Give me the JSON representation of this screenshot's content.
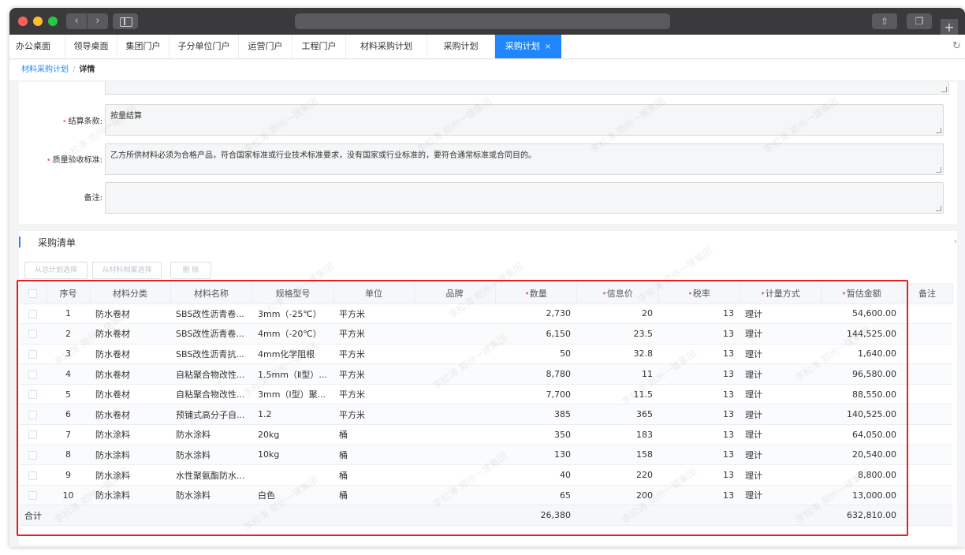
{
  "app_tabs": [
    {
      "label": "办公桌面"
    },
    {
      "label": "领导桌面"
    },
    {
      "label": "集团门户"
    },
    {
      "label": "子分单位门户"
    },
    {
      "label": "运营门户"
    },
    {
      "label": "工程门户"
    },
    {
      "label": "材料采购计划"
    },
    {
      "label": "采购计划"
    },
    {
      "label": "采购计划",
      "active": true,
      "close": "×"
    }
  ],
  "breadcrumb": {
    "link": "材料采购计划",
    "sep": "/",
    "current": "详情"
  },
  "form": {
    "settlement_label": "结算条款:",
    "settlement_value": "按量结算",
    "quality_label": "质量验收标准:",
    "quality_value": "乙方所供材料必须为合格产品，符合国家标准或行业技术标准要求，没有国家或行业标准的，要符合通常标准或合同目的。",
    "remark_label": "备注:",
    "remark_value": "",
    "required_mark": "•"
  },
  "section": {
    "title": "采购清单",
    "right_glyph": "‹"
  },
  "toolbar": {
    "btn_total": "从总计划选择",
    "btn_archive": "从材料档案选择",
    "btn_delete": "删 除"
  },
  "table": {
    "headers": [
      "",
      "序号",
      "材料分类",
      "材料名称",
      "规格型号",
      "单位",
      "品牌",
      "数量",
      "信息价",
      "税率",
      "计量方式",
      "暂估金额",
      "备注"
    ],
    "rows": [
      [
        "1",
        "防水卷材",
        "SBS改性沥青卷...",
        "3mm（-25℃）",
        "平方米",
        "",
        "2,730",
        "20",
        "13",
        "理计",
        "54,600.00",
        ""
      ],
      [
        "2",
        "防水卷材",
        "SBS改性沥青卷...",
        "4mm（-20℃）",
        "平方米",
        "",
        "6,150",
        "23.5",
        "13",
        "理计",
        "144,525.00",
        ""
      ],
      [
        "3",
        "防水卷材",
        "SBS改性沥青抗...",
        "4mm化学阻根",
        "平方米",
        "",
        "50",
        "32.8",
        "13",
        "理计",
        "1,640.00",
        ""
      ],
      [
        "4",
        "防水卷材",
        "自粘聚合物改性...",
        "1.5mm（Ⅱ型）...",
        "平方米",
        "",
        "8,780",
        "11",
        "13",
        "理计",
        "96,580.00",
        ""
      ],
      [
        "5",
        "防水卷材",
        "自粘聚合物改性...",
        "3mm（Ⅰ型）聚...",
        "平方米",
        "",
        "7,700",
        "11.5",
        "13",
        "理计",
        "88,550.00",
        ""
      ],
      [
        "6",
        "防水卷材",
        "预铺式高分子自...",
        "1.2",
        "平方米",
        "",
        "385",
        "365",
        "13",
        "理计",
        "140,525.00",
        ""
      ],
      [
        "7",
        "防水涂料",
        "防水涂料",
        "20kg",
        "桶",
        "",
        "350",
        "183",
        "13",
        "理计",
        "64,050.00",
        ""
      ],
      [
        "8",
        "防水涂料",
        "防水涂料",
        "10kg",
        "桶",
        "",
        "130",
        "158",
        "13",
        "理计",
        "20,540.00",
        ""
      ],
      [
        "9",
        "防水涂料",
        "水性聚氨酯防水...",
        "",
        "桶",
        "",
        "40",
        "220",
        "13",
        "理计",
        "8,800.00",
        ""
      ],
      [
        "10",
        "防水涂料",
        "防水涂料",
        "白色",
        "桶",
        "",
        "65",
        "200",
        "13",
        "理计",
        "13,000.00",
        ""
      ]
    ],
    "footer": {
      "label": "合计",
      "qty": "26,380",
      "amount": "632,810.00"
    }
  },
  "watermark": "李松涛 郑州一建集团",
  "colors": {
    "accent": "#1f86ff",
    "highlight_box": "#e62020",
    "required": "#f56c6c"
  }
}
